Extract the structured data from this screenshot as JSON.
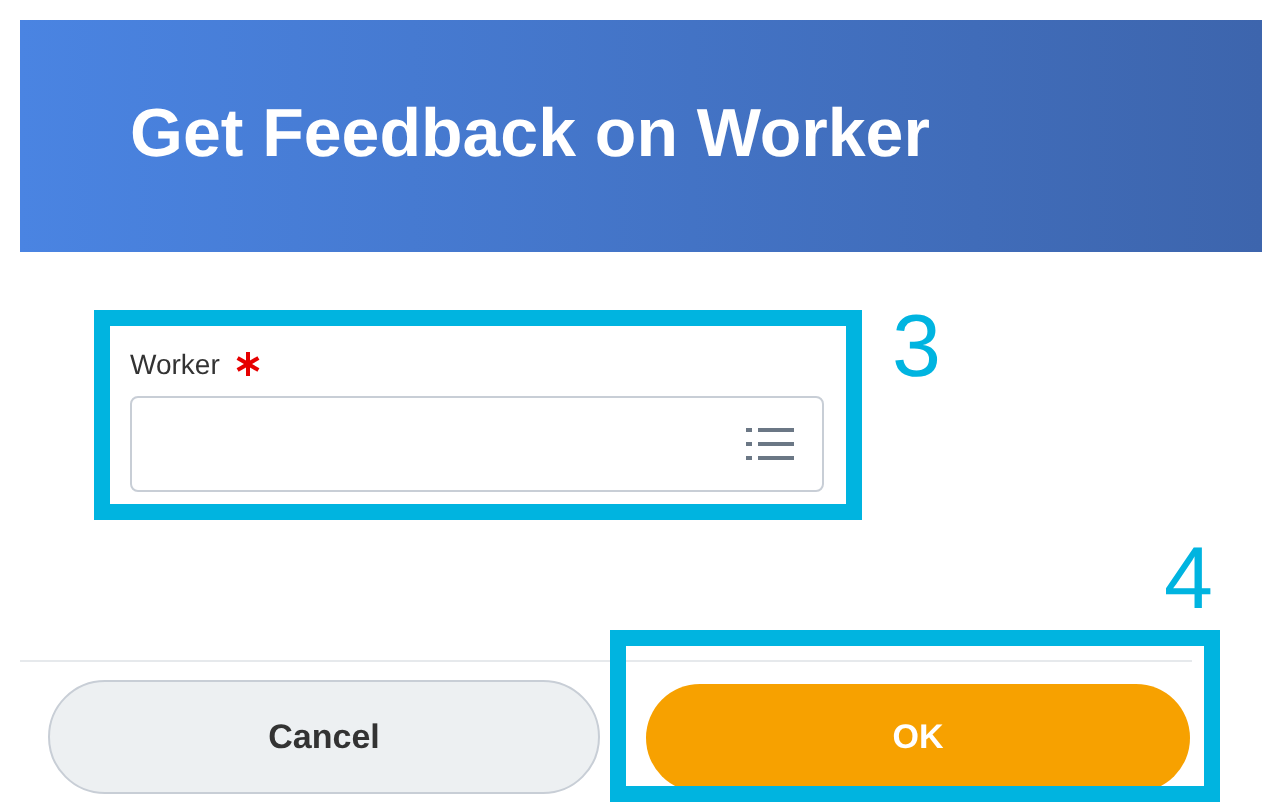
{
  "header": {
    "title": "Get Feedback on Worker"
  },
  "field": {
    "label": "Worker",
    "required": true,
    "annotation": "3"
  },
  "buttons": [
    {
      "label": "Cancel",
      "kind": "secondary"
    },
    {
      "label": "OK",
      "kind": "primary",
      "annotation": "4"
    }
  ]
}
